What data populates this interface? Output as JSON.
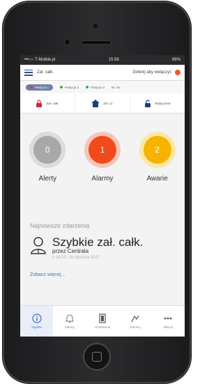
{
  "status_bar": {
    "carrier": "•••○○ T-Mobile.pl",
    "time": "15:58",
    "battery": "69%"
  },
  "topbar": {
    "title": "Zał. całk.",
    "right_text": "Dotknij aby wełączyć"
  },
  "partitions": [
    {
      "label": "Partycja 1",
      "state": "red",
      "selected": true
    },
    {
      "label": "Partycja 2",
      "state": "green"
    },
    {
      "label": "Partycja 3",
      "state": "green"
    },
    {
      "label": "W. nie"
    }
  ],
  "actions": [
    {
      "label": "Zał. całk.",
      "icon": "lock-icon"
    },
    {
      "label": "Zał. cz.",
      "icon": "home-icon"
    },
    {
      "label": "Wyłączenie",
      "icon": "unlock-icon"
    }
  ],
  "counters": [
    {
      "value": "0",
      "label": "Alerty",
      "color": "#a8a8a8",
      "halo": "#dcdcdc"
    },
    {
      "value": "1",
      "label": "Alarmy",
      "color": "#f24a1d",
      "halo": "#f7c6b8"
    },
    {
      "value": "2",
      "label": "Awarie",
      "color": "#f6b400",
      "halo": "#fbe7a8"
    }
  ],
  "events": {
    "header": "Najnowsze zdarzenia",
    "title": "Szybkie zał. całk.",
    "by": "przez Centrala",
    "time": "o 14:13, 16 stycznia 2017",
    "more": "Zobacz więcej..."
  },
  "tabs": [
    {
      "label": "Ogólne",
      "icon": "info-icon",
      "active": true
    },
    {
      "label": "Alarmy",
      "icon": "bell-icon"
    },
    {
      "label": "Urządzenia",
      "icon": "door-icon"
    },
    {
      "label": "Kamery",
      "icon": "camera-icon"
    },
    {
      "label": "Więcej",
      "icon": "more-icon"
    }
  ]
}
